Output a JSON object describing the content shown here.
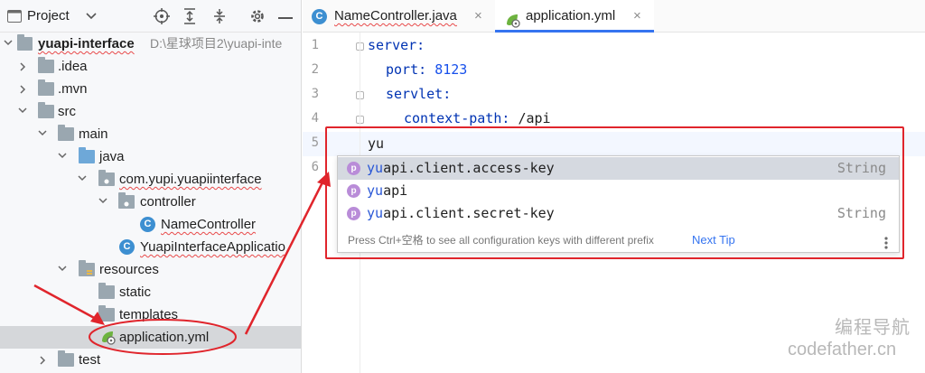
{
  "project_panel": {
    "title": "Project",
    "tree": [
      {
        "label": "yuapi-interface",
        "path": "D:\\星球项目2\\yuapi-inte",
        "bold": true,
        "squiggle": true
      },
      {
        "label": ".idea"
      },
      {
        "label": ".mvn"
      },
      {
        "label": "src"
      },
      {
        "label": "main"
      },
      {
        "label": "java"
      },
      {
        "label": "com.yupi.yuapiinterface",
        "squiggle": true
      },
      {
        "label": "controller"
      },
      {
        "label": "NameController",
        "squiggle": true
      },
      {
        "label": "YuapiInterfaceApplicatio",
        "squiggle": true
      },
      {
        "label": "resources"
      },
      {
        "label": "static"
      },
      {
        "label": "templates"
      },
      {
        "label": "application.yml"
      },
      {
        "label": "test"
      }
    ],
    "icons": {
      "c_badge": "C"
    }
  },
  "editor": {
    "tabs": [
      {
        "label": "NameController.java",
        "close": "×"
      },
      {
        "label": "application.yml",
        "close": "×"
      }
    ],
    "line_numbers": [
      "1",
      "2",
      "3",
      "4",
      "5",
      "6"
    ],
    "code": {
      "l1_key": "server:",
      "l2_key": "port:",
      "l2_val": "8123",
      "l3_key": "servlet:",
      "l4_key": "context-path:",
      "l4_val": "/api",
      "l5_text": "yu"
    }
  },
  "completion": {
    "badge": "p",
    "items": [
      {
        "match": "yu",
        "rest": "api.client.access-key",
        "type": "String"
      },
      {
        "match": "yu",
        "rest": "api",
        "type": ""
      },
      {
        "match": "yu",
        "rest": "api.client.secret-key",
        "type": "String"
      }
    ],
    "footer_hint": "Press Ctrl+空格 to see all configuration keys with different prefix",
    "next_tip": "Next Tip"
  },
  "watermark": {
    "line1": "编程导航",
    "line2": "codefather.cn"
  },
  "colors": {
    "accent": "#3574f0",
    "annotation_red": "#e0252c",
    "yaml_key": "#0033b3",
    "yaml_value": "#1750eb"
  }
}
